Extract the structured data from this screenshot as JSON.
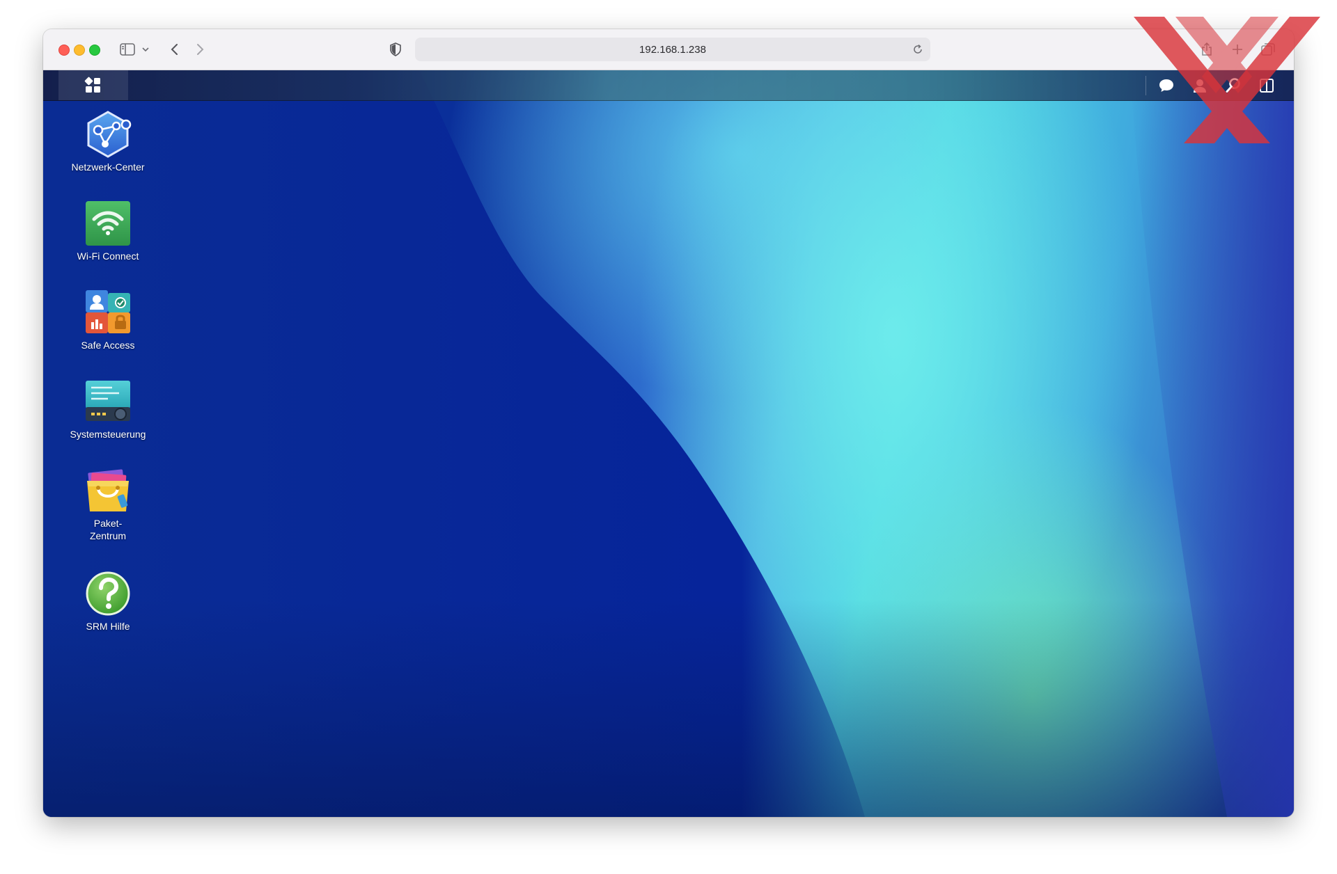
{
  "browser": {
    "url": "192.168.1.238"
  },
  "srm": {
    "desktop_icons": [
      {
        "label": "Netzwerk-Center",
        "icon": "network-center-icon"
      },
      {
        "label": "Wi-Fi Connect",
        "icon": "wifi-connect-icon"
      },
      {
        "label": "Safe Access",
        "icon": "safe-access-icon"
      },
      {
        "label": "Systemsteuerung",
        "icon": "control-panel-icon"
      },
      {
        "label": "Paket-\nZentrum",
        "icon": "package-center-icon"
      },
      {
        "label": "SRM Hilfe",
        "icon": "help-icon"
      }
    ]
  },
  "colors": {
    "srm_dark_blue": "#0a2f9a",
    "srm_cyan": "#4dd6e2",
    "srm_green": "#6ee8b4",
    "watermark_red": "#d9343a"
  }
}
